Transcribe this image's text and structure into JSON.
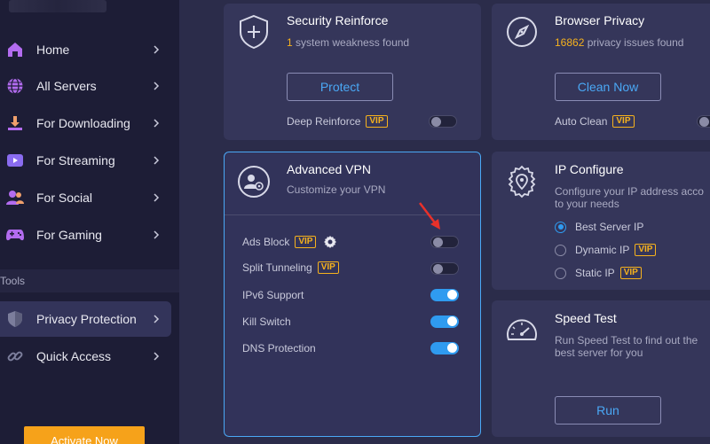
{
  "sidebar": {
    "items": [
      {
        "label": "Home",
        "icon": "home-icon"
      },
      {
        "label": "All Servers",
        "icon": "globe-icon"
      },
      {
        "label": "For Downloading",
        "icon": "download-icon"
      },
      {
        "label": "For Streaming",
        "icon": "play-icon"
      },
      {
        "label": "For Social",
        "icon": "users-icon"
      },
      {
        "label": "For Gaming",
        "icon": "gamepad-icon"
      }
    ],
    "tools_label": "Tools",
    "tools_items": [
      {
        "label": "Privacy Protection",
        "icon": "shield-icon",
        "active": true
      },
      {
        "label": "Quick Access",
        "icon": "link-icon",
        "active": false
      }
    ],
    "activate_label": "Activate Now"
  },
  "security": {
    "title": "Security Reinforce",
    "count": "1",
    "subtitle_rest": " system weakness found",
    "button": "Protect",
    "option_label": "Deep Reinforce",
    "vip": "VIP",
    "toggle_on": false
  },
  "browser": {
    "title": "Browser Privacy",
    "count": "16862",
    "subtitle_rest": " privacy issues found",
    "button": "Clean Now",
    "option_label": "Auto Clean",
    "vip": "VIP",
    "toggle_on": false
  },
  "vpn": {
    "title": "Advanced VPN",
    "subtitle": "Customize your VPN",
    "rows": [
      {
        "label": "Ads Block",
        "vip": "VIP",
        "on": false
      },
      {
        "label": "Split Tunneling",
        "vip": "VIP",
        "on": false
      },
      {
        "label": "IPv6 Support",
        "vip": "",
        "on": true
      },
      {
        "label": "Kill Switch",
        "vip": "",
        "on": true
      },
      {
        "label": "DNS Protection",
        "vip": "",
        "on": true
      }
    ]
  },
  "ip": {
    "title": "IP Configure",
    "subtitle_line1": "Configure your IP address acco",
    "subtitle_line2": "to your needs",
    "options": [
      {
        "label": "Best Server IP",
        "vip": "",
        "checked": true
      },
      {
        "label": "Dynamic IP",
        "vip": "VIP",
        "checked": false
      },
      {
        "label": "Static IP",
        "vip": "VIP",
        "checked": false
      }
    ]
  },
  "speed": {
    "title": "Speed Test",
    "subtitle_line1": "Run Speed Test to find out the",
    "subtitle_line2": "best server for you",
    "button": "Run"
  },
  "colors": {
    "accent": "#2f9bf0",
    "vip": "#f6b21d",
    "activate": "#f6a21a",
    "sidebar_bg": "#1d1d36",
    "card_bg": "#35365a"
  }
}
